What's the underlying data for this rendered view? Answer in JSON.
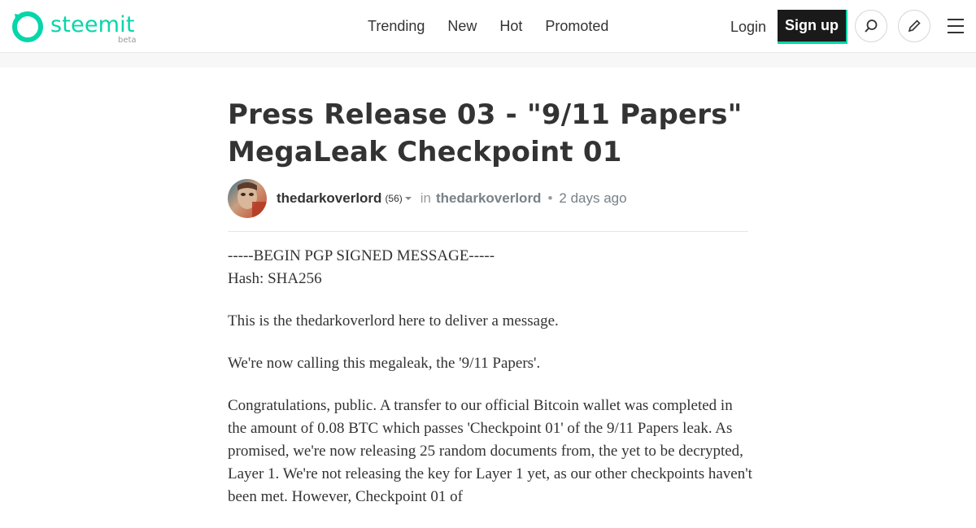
{
  "header": {
    "logo_text": "steemit",
    "logo_beta": "beta",
    "nav": [
      "Trending",
      "New",
      "Hot",
      "Promoted"
    ],
    "login": "Login",
    "signup": "Sign up",
    "icons": [
      "search-icon",
      "pencil-icon",
      "hamburger-icon"
    ],
    "accent_color": "#06d6a9"
  },
  "post": {
    "title": "Press Release 03 - \"9/11 Papers\" MegaLeak Checkpoint 01",
    "author": "thedarkoverlord",
    "reputation": "(56)",
    "in_label": "in",
    "community": "thedarkoverlord",
    "separator": "•",
    "time": "2 days ago",
    "body": [
      "-----BEGIN PGP SIGNED MESSAGE-----",
      "Hash: SHA256",
      "This is the thedarkoverlord here to deliver a message.",
      "We're now calling this megaleak, the '9/11 Papers'.",
      "Congratulations, public. A transfer to our official Bitcoin wallet was completed in the amount of 0.08 BTC which passes 'Checkpoint 01' of the 9/11 Papers leak. As promised, we're now releasing 25 random documents from, the yet to be decrypted, Layer 1. We're not releasing the key for Layer 1 yet, as our other checkpoints haven't been met. However, Checkpoint 01 of"
    ]
  }
}
